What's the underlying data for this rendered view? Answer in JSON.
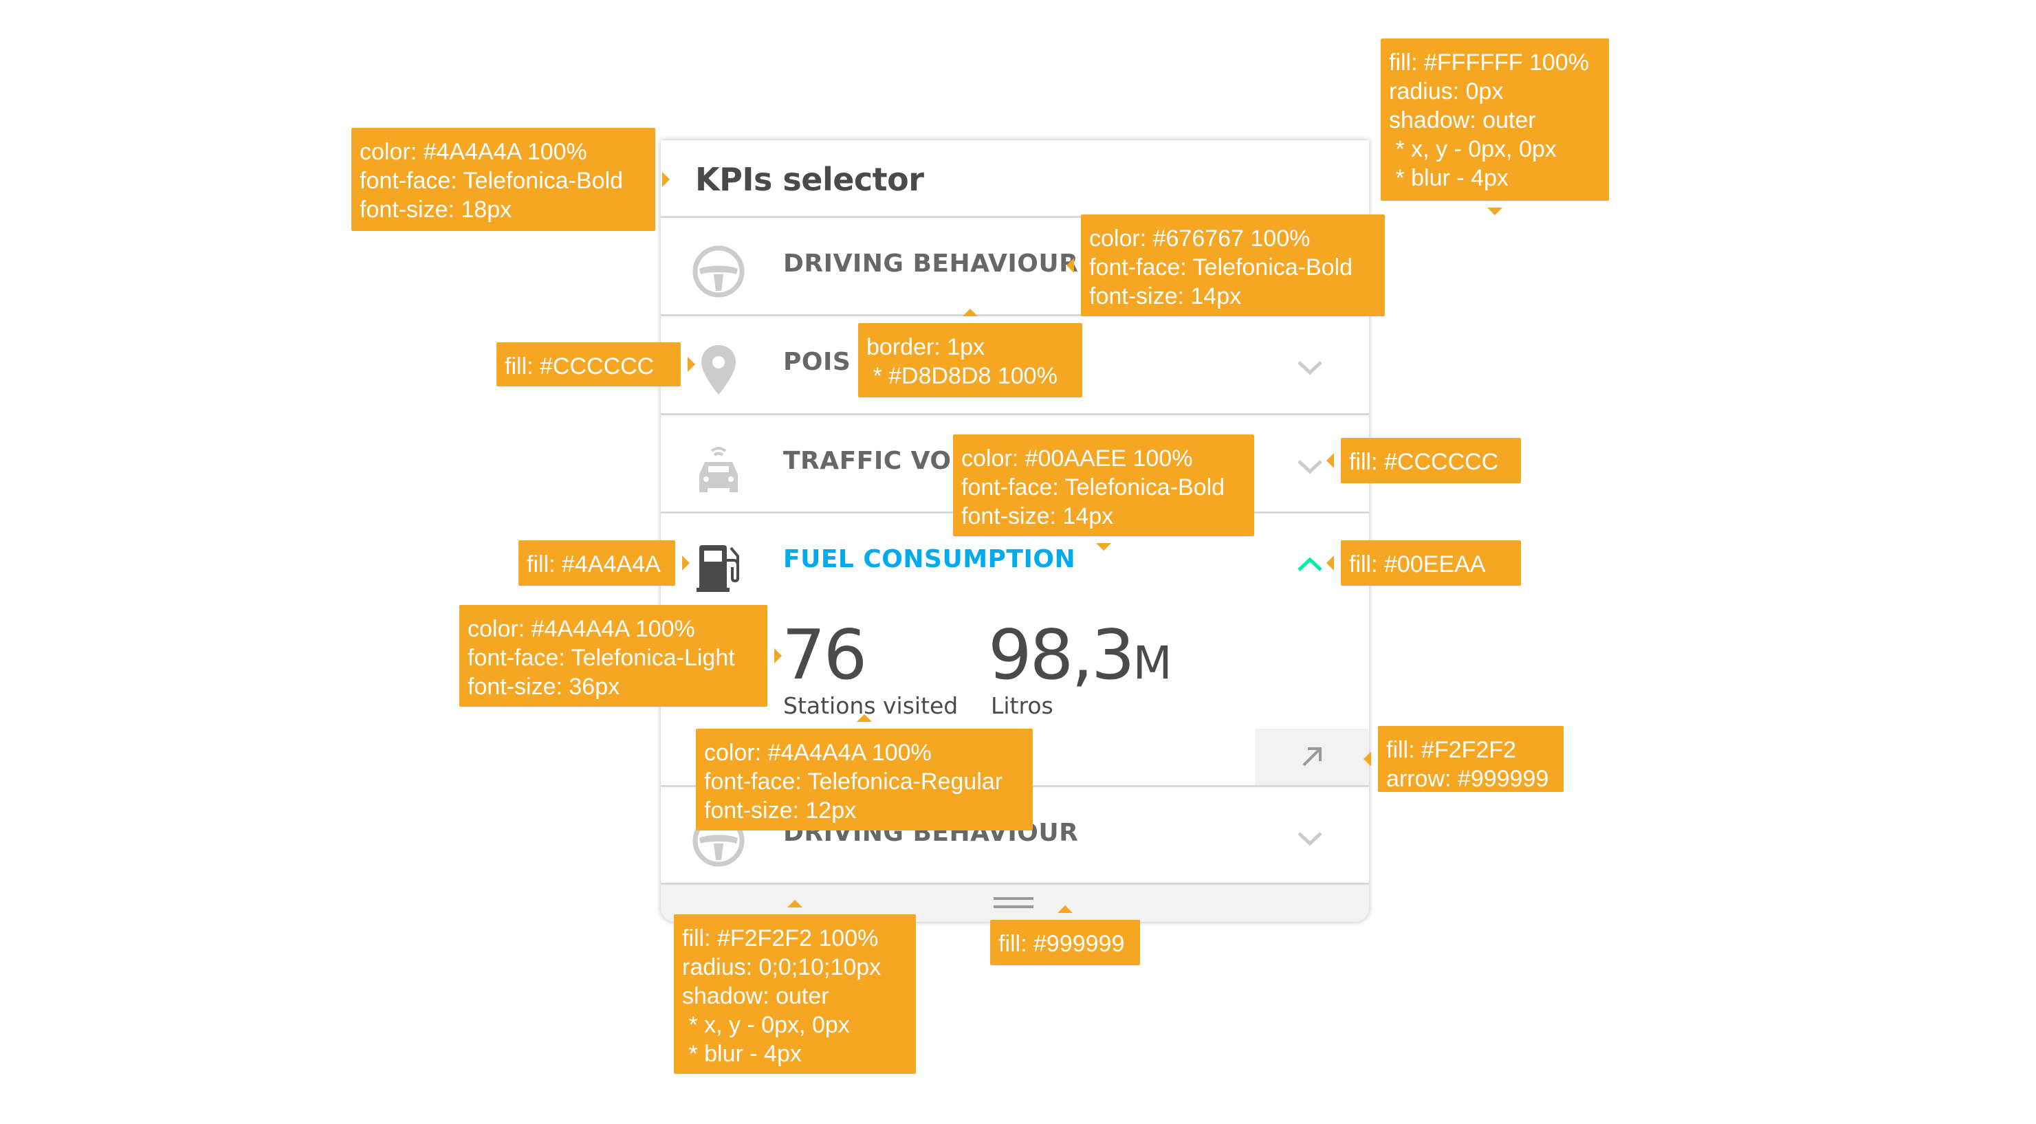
{
  "panel": {
    "title": "KPIs selector",
    "rows": [
      {
        "label": "DRIVING BEHAVIOUR",
        "icon": "steering-wheel-icon"
      },
      {
        "label": "POIS",
        "icon": "map-pin-icon",
        "chevron": "chevron-down-icon"
      },
      {
        "label": "TRAFFIC VOLUME",
        "icon": "connected-car-icon",
        "chevron": "chevron-down-icon"
      },
      {
        "label": "FUEL CONSUMPTION",
        "icon": "fuel-pump-icon",
        "chevron": "chevron-up-icon"
      },
      {
        "label": "DRIVING BEHAVIOUR",
        "icon": "steering-wheel-icon",
        "chevron": "chevron-down-icon"
      }
    ],
    "stats": [
      {
        "value": "76",
        "unit": "",
        "label": "Stations visited"
      },
      {
        "value": "98,3",
        "unit": "M",
        "label": "Litros"
      }
    ],
    "expand_icon": "arrow-up-right-icon",
    "footer_icon": "drag-handle-icon"
  },
  "colors": {
    "title": "#4A4A4A",
    "label": "#676767",
    "active": "#00AAEE",
    "active_chevron": "#00EEAA",
    "icon_muted": "#CCCCCC",
    "icon_active": "#4A4A4A",
    "border": "#D8D8D8",
    "footer_fill": "#F2F2F2",
    "arrow": "#999999",
    "annotation_fill": "#F5A623"
  },
  "annotations": {
    "panel_fill": "fill: #FFFFFF 100%\nradius: 0px\nshadow: outer\n * x, y - 0px, 0px\n * blur - 4px",
    "title_font": "color: #4A4A4A 100%\nfont-face: Telefonica-Bold\nfont-size: 18px",
    "label_font": "color: #676767 100%\nfont-face: Telefonica-Bold\nfont-size: 14px",
    "icon_fill": "fill: #CCCCCC",
    "border": "border: 1px\n * #D8D8D8 100%",
    "chevron_fill": "fill: #CCCCCC",
    "active_font": "color: #00AAEE 100%\nfont-face: Telefonica-Bold\nfont-size: 14px",
    "active_icon_fill": "fill: #4A4A4A",
    "active_chevron_fill": "fill: #00EEAA",
    "stat_font": "color: #4A4A4A 100%\nfont-face: Telefonica-Light\nfont-size: 36px",
    "stat_label_font": "color: #4A4A4A 100%\nfont-face: Telefonica-Regular\nfont-size: 12px",
    "expand_fill": "fill: #F2F2F2\narrow: #999999",
    "footer_fill": "fill: #F2F2F2 100%\nradius: 0;0;10;10px\nshadow: outer\n * x, y - 0px, 0px\n * blur - 4px",
    "handle_fill": "fill: #999999"
  }
}
